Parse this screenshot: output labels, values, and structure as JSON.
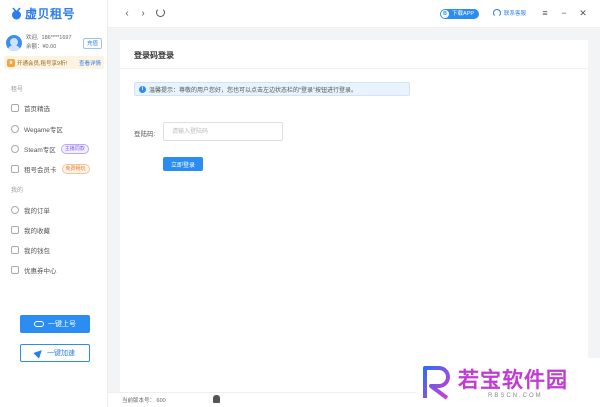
{
  "app": {
    "name": "虚贝租号"
  },
  "user": {
    "welcome": "欢迎,",
    "phone": "186****1697",
    "balance": "余额：¥0.00",
    "recharge_label": "充值"
  },
  "vip": {
    "text": "开通会员,租号享9折!",
    "link": "查看详情"
  },
  "sidebar": {
    "section_rent": "租号",
    "rent_items": [
      {
        "label": "首页精选",
        "icon": "home-icon"
      },
      {
        "label": "Wegame专区",
        "icon": "wegame-icon"
      },
      {
        "label": "Steam专区",
        "icon": "steam-icon",
        "tag": "主播同款"
      },
      {
        "label": "租号会员卡",
        "icon": "vip-card-icon",
        "tag": "免费畅玩"
      }
    ],
    "section_mine": "我的",
    "mine_items": [
      {
        "label": "我的订单",
        "icon": "order-icon"
      },
      {
        "label": "我的收藏",
        "icon": "favorite-icon"
      },
      {
        "label": "我的钱包",
        "icon": "wallet-icon"
      },
      {
        "label": "优惠券中心",
        "icon": "coupon-icon"
      }
    ],
    "quick_login": "一键上号",
    "accelerate": "一键加速"
  },
  "topbar": {
    "download_app": "下载APP",
    "support": "联系客服"
  },
  "main": {
    "title": "登录码登录",
    "notice": "温馨提示：尊敬的用户您好，您也可以点击左边状态栏的“登录”按钮进行登录。",
    "field_label": "登陆码:",
    "field_placeholder": "请输入登陆码",
    "login_button": "立即登录"
  },
  "footer": {
    "version": "当前版本号： 600"
  },
  "watermark": {
    "name": "若宝软件园",
    "domain": "RBSCN.COM"
  },
  "colors": {
    "accent": "#2b8df2",
    "purple": "#7b5df5",
    "orange": "#f07b2e",
    "watermark": "#c13ad4"
  }
}
